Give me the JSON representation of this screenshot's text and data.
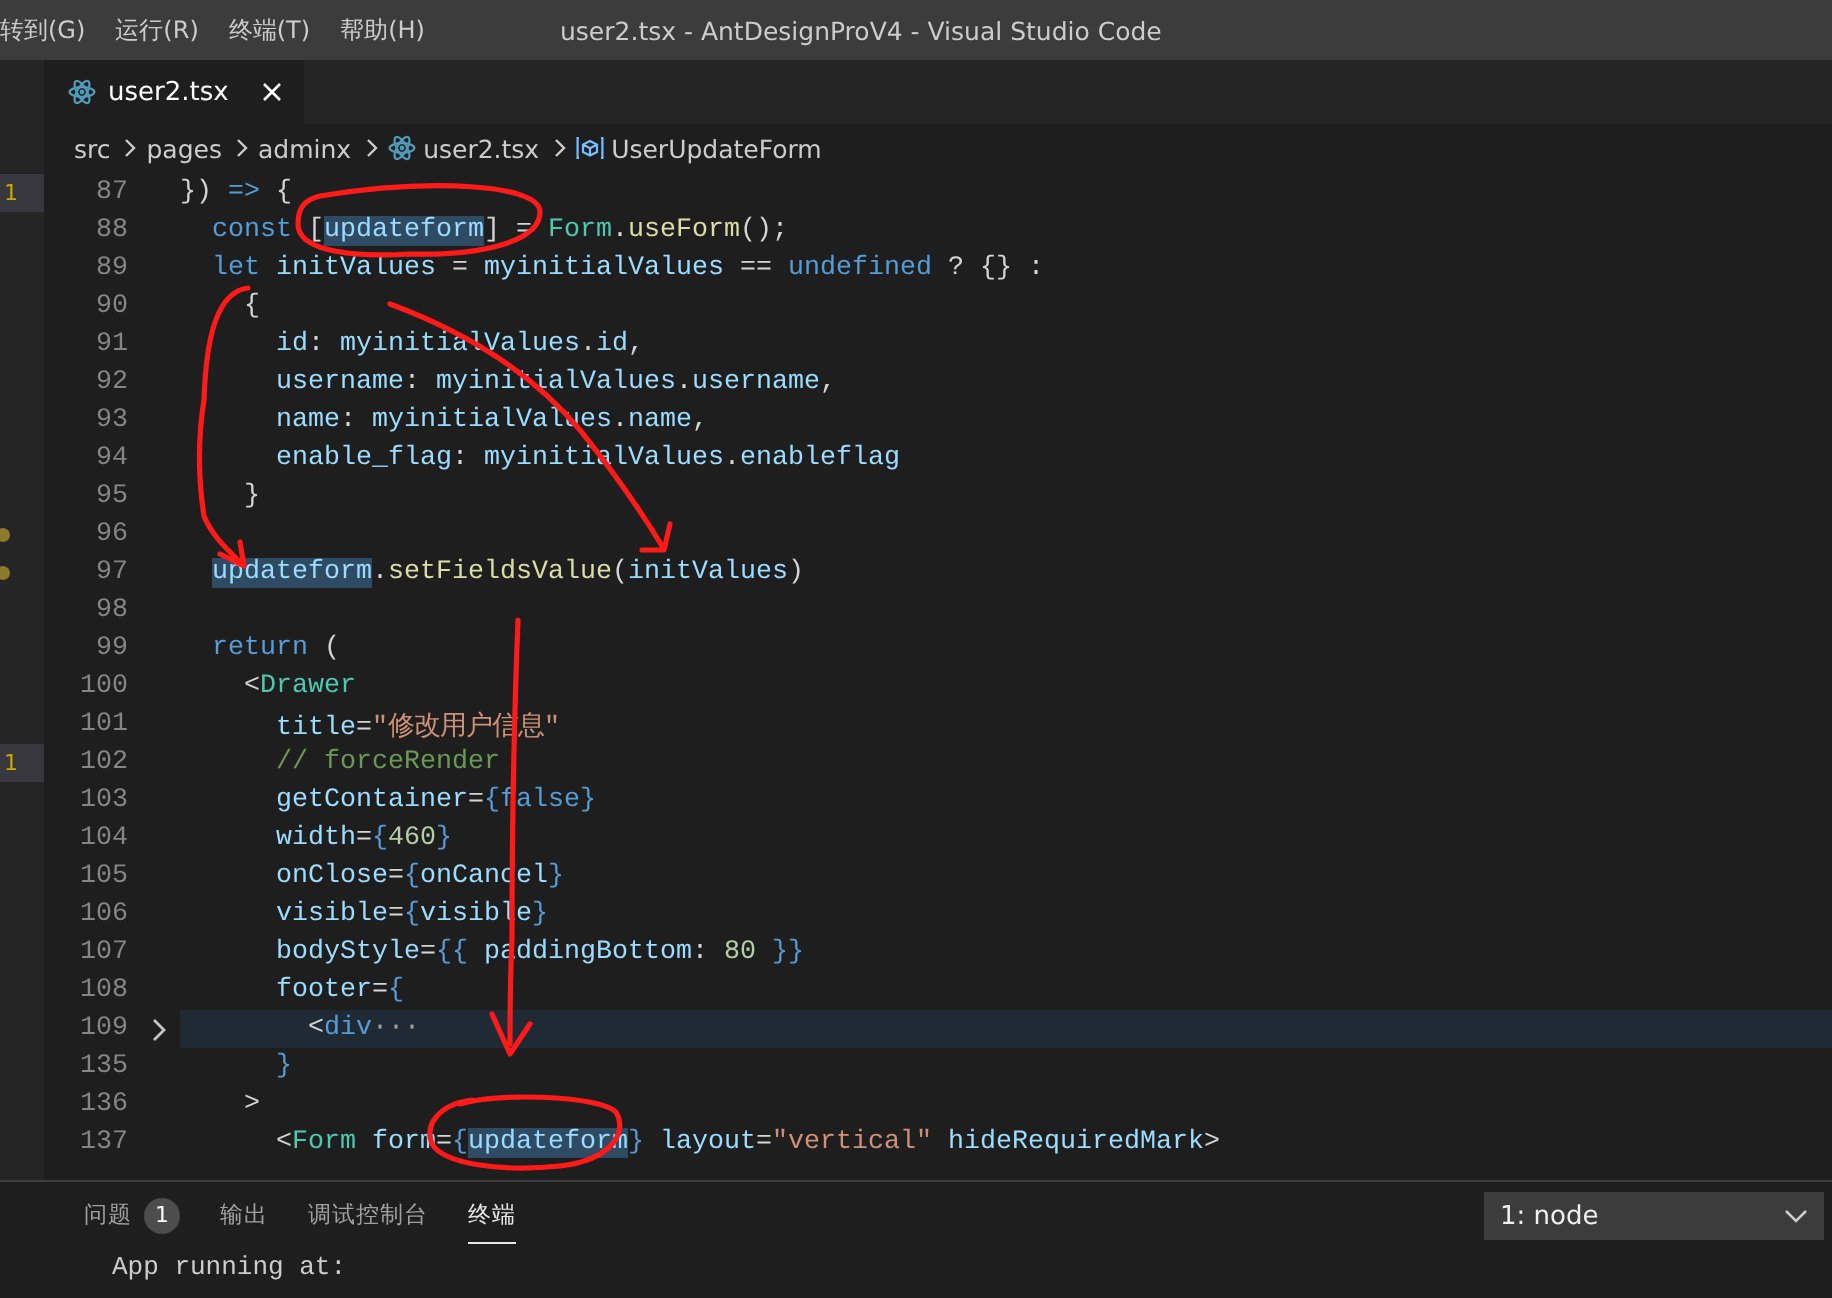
{
  "window": {
    "title": "user2.tsx - AntDesignProV4 - Visual Studio Code"
  },
  "menu": [
    "转到(G)",
    "运行(R)",
    "终端(T)",
    "帮助(H)"
  ],
  "tabs": [
    {
      "label": "user2.tsx",
      "selected": true
    }
  ],
  "breadcrumb": [
    {
      "kind": "folder",
      "label": "src"
    },
    {
      "kind": "folder",
      "label": "pages"
    },
    {
      "kind": "folder",
      "label": "adminx"
    },
    {
      "kind": "file",
      "label": "user2.tsx"
    },
    {
      "kind": "symbol",
      "label": "UserUpdateForm"
    }
  ],
  "editor": {
    "lines": [
      {
        "number": "87",
        "side_badge": "1",
        "tokens": [
          {
            "kind": "punc",
            "text": "}) "
          },
          {
            "kind": "kw",
            "text": "=>"
          },
          {
            "kind": "punc",
            "text": " {"
          }
        ]
      },
      {
        "number": "88",
        "tokens": [
          {
            "kind": "kw",
            "text": "  const"
          },
          {
            "kind": "punc",
            "text": " ["
          },
          {
            "kind": "var",
            "text": "updateform",
            "highlighted": true
          },
          {
            "kind": "punc",
            "text": "] = "
          },
          {
            "kind": "type",
            "text": "Form"
          },
          {
            "kind": "punc",
            "text": "."
          },
          {
            "kind": "fn",
            "text": "useForm"
          },
          {
            "kind": "punc",
            "text": "();"
          }
        ]
      },
      {
        "number": "89",
        "tokens": [
          {
            "kind": "kw",
            "text": "  let"
          },
          {
            "kind": "var",
            "text": " initValues"
          },
          {
            "kind": "punc",
            "text": " = "
          },
          {
            "kind": "var",
            "text": "myinitialValues"
          },
          {
            "kind": "punc",
            "text": " == "
          },
          {
            "kind": "kw",
            "text": "undefined"
          },
          {
            "kind": "punc",
            "text": " ? {} :"
          }
        ]
      },
      {
        "number": "90",
        "tokens": [
          {
            "kind": "punc",
            "text": "    {"
          }
        ]
      },
      {
        "number": "91",
        "tokens": [
          {
            "kind": "var",
            "text": "      id"
          },
          {
            "kind": "punc",
            "text": ": "
          },
          {
            "kind": "var",
            "text": "myinitialValues"
          },
          {
            "kind": "punc",
            "text": "."
          },
          {
            "kind": "var",
            "text": "id"
          },
          {
            "kind": "punc",
            "text": ","
          }
        ]
      },
      {
        "number": "92",
        "tokens": [
          {
            "kind": "var",
            "text": "      username"
          },
          {
            "kind": "punc",
            "text": ": "
          },
          {
            "kind": "var",
            "text": "myinitialValues"
          },
          {
            "kind": "punc",
            "text": "."
          },
          {
            "kind": "var",
            "text": "username"
          },
          {
            "kind": "punc",
            "text": ","
          }
        ]
      },
      {
        "number": "93",
        "tokens": [
          {
            "kind": "var",
            "text": "      name"
          },
          {
            "kind": "punc",
            "text": ": "
          },
          {
            "kind": "var",
            "text": "myinitialValues"
          },
          {
            "kind": "punc",
            "text": "."
          },
          {
            "kind": "var",
            "text": "name"
          },
          {
            "kind": "punc",
            "text": ","
          }
        ]
      },
      {
        "number": "94",
        "tokens": [
          {
            "kind": "var",
            "text": "      enable_flag"
          },
          {
            "kind": "punc",
            "text": ": "
          },
          {
            "kind": "var",
            "text": "myinitialValues"
          },
          {
            "kind": "punc",
            "text": "."
          },
          {
            "kind": "var",
            "text": "enableflag"
          }
        ]
      },
      {
        "number": "95",
        "tokens": [
          {
            "kind": "punc",
            "text": "    }"
          }
        ]
      },
      {
        "number": "96",
        "side_dot": true
      },
      {
        "number": "97",
        "side_dot": true,
        "tokens": [
          {
            "kind": "var",
            "text": "  updateform",
            "highlighted": true
          },
          {
            "kind": "punc",
            "text": "."
          },
          {
            "kind": "fn",
            "text": "setFieldsValue"
          },
          {
            "kind": "punc",
            "text": "("
          },
          {
            "kind": "var",
            "text": "initValues"
          },
          {
            "kind": "punc",
            "text": ")"
          }
        ]
      },
      {
        "number": "98"
      },
      {
        "number": "99",
        "tokens": [
          {
            "kind": "kw",
            "text": "  return"
          },
          {
            "kind": "punc",
            "text": " ("
          }
        ]
      },
      {
        "number": "100",
        "tokens": [
          {
            "kind": "punc",
            "text": "    <"
          },
          {
            "kind": "type",
            "text": "Drawer"
          }
        ]
      },
      {
        "number": "101",
        "tokens": [
          {
            "kind": "var",
            "text": "      title"
          },
          {
            "kind": "punc",
            "text": "="
          },
          {
            "kind": "str",
            "text": "\"修改用户信息\""
          }
        ]
      },
      {
        "number": "102",
        "side_badge": "1",
        "tokens": [
          {
            "kind": "cmt",
            "text": "      // forceRender"
          }
        ]
      },
      {
        "number": "103",
        "tokens": [
          {
            "kind": "var",
            "text": "      getContainer"
          },
          {
            "kind": "punc",
            "text": "="
          },
          {
            "kind": "kw",
            "text": "{false}"
          }
        ]
      },
      {
        "number": "104",
        "tokens": [
          {
            "kind": "var",
            "text": "      width"
          },
          {
            "kind": "punc",
            "text": "="
          },
          {
            "kind": "kw",
            "text": "{"
          },
          {
            "kind": "num",
            "text": "460"
          },
          {
            "kind": "kw",
            "text": "}"
          }
        ]
      },
      {
        "number": "105",
        "tokens": [
          {
            "kind": "var",
            "text": "      onClose"
          },
          {
            "kind": "punc",
            "text": "="
          },
          {
            "kind": "kw",
            "text": "{"
          },
          {
            "kind": "var",
            "text": "onCancel"
          },
          {
            "kind": "kw",
            "text": "}"
          }
        ]
      },
      {
        "number": "106",
        "tokens": [
          {
            "kind": "var",
            "text": "      visible"
          },
          {
            "kind": "punc",
            "text": "="
          },
          {
            "kind": "kw",
            "text": "{"
          },
          {
            "kind": "var",
            "text": "visible"
          },
          {
            "kind": "kw",
            "text": "}"
          }
        ]
      },
      {
        "number": "107",
        "tokens": [
          {
            "kind": "var",
            "text": "      bodyStyle"
          },
          {
            "kind": "punc",
            "text": "="
          },
          {
            "kind": "kw",
            "text": "{{"
          },
          {
            "kind": "var",
            "text": " paddingBottom"
          },
          {
            "kind": "punc",
            "text": ": "
          },
          {
            "kind": "num",
            "text": "80"
          },
          {
            "kind": "kw",
            "text": " }}"
          }
        ]
      },
      {
        "number": "108",
        "tokens": [
          {
            "kind": "var",
            "text": "      footer"
          },
          {
            "kind": "punc",
            "text": "="
          },
          {
            "kind": "kw",
            "text": "{"
          }
        ]
      },
      {
        "number": "109",
        "current": true,
        "folded": true,
        "tokens": [
          {
            "kind": "punc",
            "text": "        <"
          },
          {
            "kind": "kw",
            "text": "div"
          },
          {
            "kind": "fold",
            "text": "···"
          }
        ]
      },
      {
        "number": "135",
        "tokens": [
          {
            "kind": "kw",
            "text": "      }"
          }
        ]
      },
      {
        "number": "136",
        "tokens": [
          {
            "kind": "punc",
            "text": "    >"
          }
        ]
      },
      {
        "number": "137",
        "tokens": [
          {
            "kind": "punc",
            "text": "      <"
          },
          {
            "kind": "type",
            "text": "Form"
          },
          {
            "kind": "var",
            "text": " form"
          },
          {
            "kind": "punc",
            "text": "="
          },
          {
            "kind": "kw",
            "text": "{"
          },
          {
            "kind": "var",
            "text": "updateform",
            "highlighted": true
          },
          {
            "kind": "kw",
            "text": "}"
          },
          {
            "kind": "var",
            "text": " layout"
          },
          {
            "kind": "punc",
            "text": "="
          },
          {
            "kind": "str",
            "text": "\"vertical\""
          },
          {
            "kind": "var",
            "text": " hideRequiredMark"
          },
          {
            "kind": "punc",
            "text": ">"
          }
        ]
      }
    ]
  },
  "panel": {
    "tabs": [
      {
        "label": "问题",
        "badge": "1",
        "selected": false
      },
      {
        "label": "输出",
        "selected": false
      },
      {
        "label": "调试控制台",
        "selected": false
      },
      {
        "label": "终端",
        "selected": true
      }
    ],
    "terminal_select": "1: node",
    "terminal_lines": [
      "App running at:"
    ]
  }
}
